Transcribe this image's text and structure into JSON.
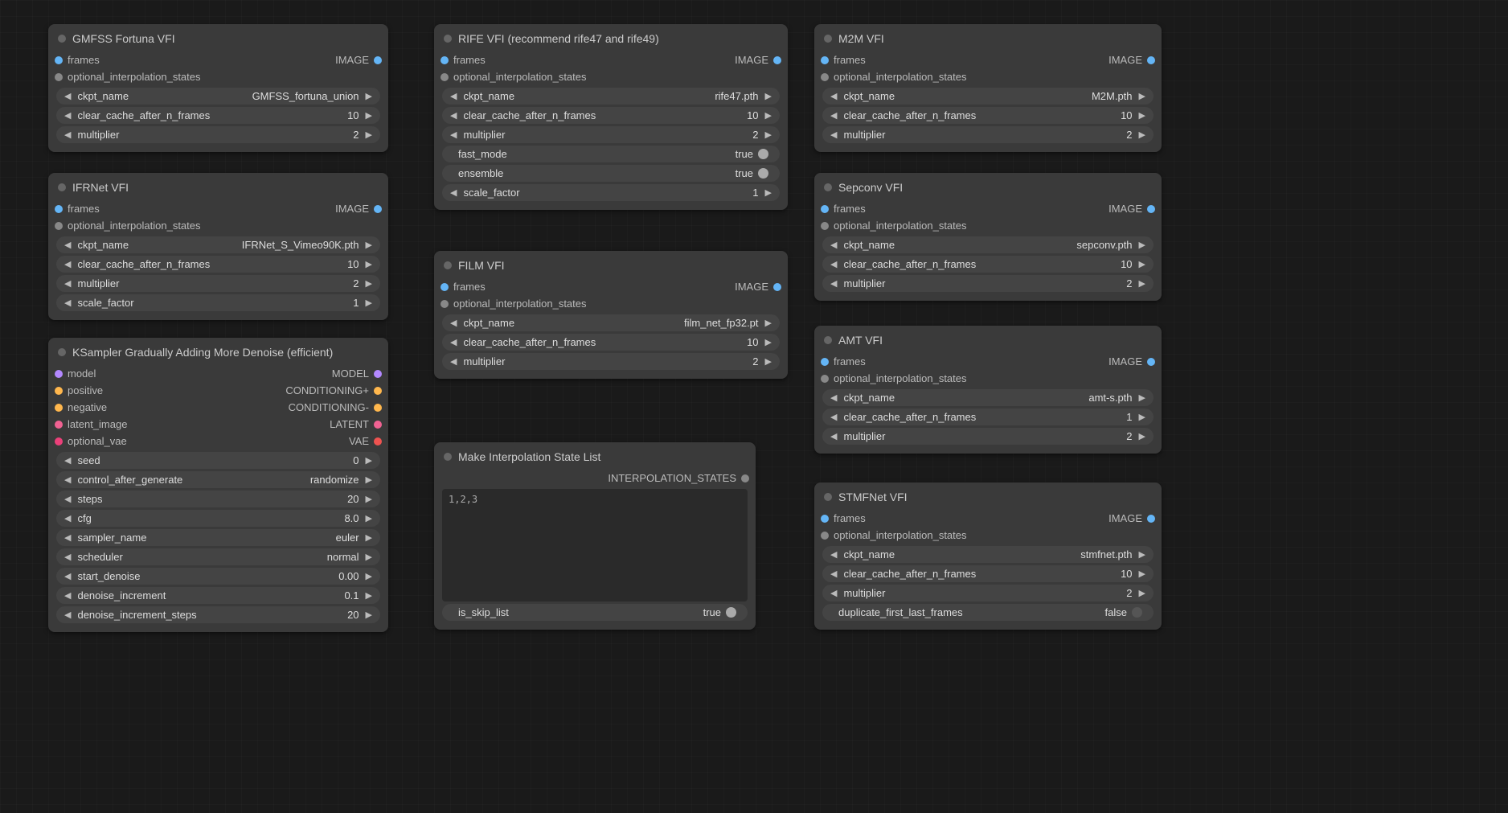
{
  "labels": {
    "frames": "frames",
    "optional_interpolation_states": "optional_interpolation_states",
    "image": "IMAGE",
    "ckpt_name": "ckpt_name",
    "clear_cache": "clear_cache_after_n_frames",
    "multiplier": "multiplier",
    "scale_factor": "scale_factor",
    "fast_mode": "fast_mode",
    "ensemble": "ensemble",
    "is_skip_list": "is_skip_list",
    "dup_frames": "duplicate_first_last_frames",
    "true": "true",
    "false": "false"
  },
  "nodes": {
    "gmfss": {
      "title": "GMFSS Fortuna VFI",
      "ckpt": "GMFSS_fortuna_union",
      "clear": "10",
      "mult": "2"
    },
    "ifrnet": {
      "title": "IFRNet VFI",
      "ckpt": "IFRNet_S_Vimeo90K.pth",
      "clear": "10",
      "mult": "2",
      "scale": "1"
    },
    "ksampler": {
      "title": "KSampler Gradually Adding More Denoise (efficient)",
      "in": {
        "model": "model",
        "positive": "positive",
        "negative": "negative",
        "latent": "latent_image",
        "vae": "optional_vae"
      },
      "out": {
        "model": "MODEL",
        "cond_pos": "CONDITIONING+",
        "cond_neg": "CONDITIONING-",
        "latent": "LATENT",
        "vae": "VAE"
      },
      "params": {
        "seed_lbl": "seed",
        "seed": "0",
        "cag_lbl": "control_after_generate",
        "cag": "randomize",
        "steps_lbl": "steps",
        "steps": "20",
        "cfg_lbl": "cfg",
        "cfg": "8.0",
        "sampler_lbl": "sampler_name",
        "sampler": "euler",
        "sched_lbl": "scheduler",
        "sched": "normal",
        "sd_lbl": "start_denoise",
        "sd": "0.00",
        "di_lbl": "denoise_increment",
        "di": "0.1",
        "dis_lbl": "denoise_increment_steps",
        "dis": "20"
      }
    },
    "rife": {
      "title": "RIFE VFI (recommend rife47 and rife49)",
      "ckpt": "rife47.pth",
      "clear": "10",
      "mult": "2",
      "scale": "1"
    },
    "film": {
      "title": "FILM VFI",
      "ckpt": "film_net_fp32.pt",
      "clear": "10",
      "mult": "2"
    },
    "misl": {
      "title": "Make Interpolation State List",
      "out": "INTERPOLATION_STATES",
      "text": "1,2,3"
    },
    "m2m": {
      "title": "M2M VFI",
      "ckpt": "M2M.pth",
      "clear": "10",
      "mult": "2"
    },
    "sepconv": {
      "title": "Sepconv VFI",
      "ckpt": "sepconv.pth",
      "clear": "10",
      "mult": "2"
    },
    "amt": {
      "title": "AMT VFI",
      "ckpt": "amt-s.pth",
      "clear": "1",
      "mult": "2"
    },
    "stmf": {
      "title": "STMFNet VFI",
      "ckpt": "stmfnet.pth",
      "clear": "10",
      "mult": "2"
    }
  }
}
